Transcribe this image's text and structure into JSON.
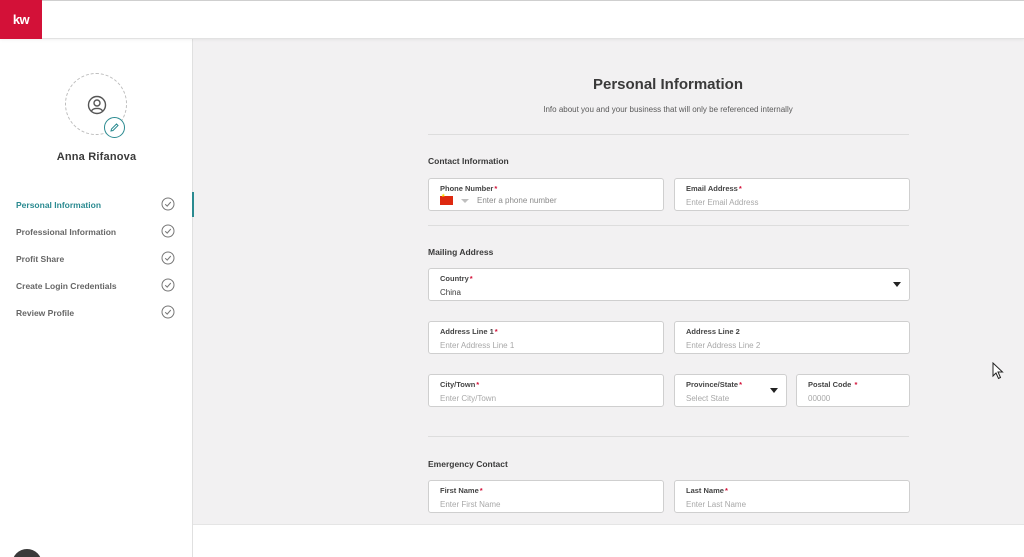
{
  "app": {
    "logo_text": "kw",
    "accent_color": "#d31138",
    "primary_color": "#2a8a90"
  },
  "sidebar": {
    "user_name": "Anna Rifanova",
    "items": [
      {
        "label": "Personal Information",
        "active": true
      },
      {
        "label": "Professional Information",
        "active": false
      },
      {
        "label": "Profit Share",
        "active": false
      },
      {
        "label": "Create Login Credentials",
        "active": false
      },
      {
        "label": "Review Profile",
        "active": false
      }
    ]
  },
  "main": {
    "title": "Personal Information",
    "subtitle": "Info about you and your business that will only be referenced internally",
    "contact": {
      "title": "Contact Information",
      "phone": {
        "label": "Phone Number",
        "placeholder": "Enter a phone number",
        "flag_icon": "china-flag-icon"
      },
      "email": {
        "label": "Email Address",
        "placeholder": "Enter Email Address"
      }
    },
    "mailing": {
      "title": "Mailing Address",
      "country": {
        "label": "Country",
        "value": "China"
      },
      "address1": {
        "label": "Address Line 1",
        "placeholder": "Enter Address Line 1"
      },
      "address2": {
        "label": "Address Line 2",
        "placeholder": "Enter Address Line 2"
      },
      "city": {
        "label": "City/Town",
        "placeholder": "Enter City/Town"
      },
      "province": {
        "label": "Province/State",
        "placeholder": "Select State"
      },
      "postal": {
        "label": "Postal Code",
        "placeholder": "00000"
      }
    },
    "emergency": {
      "title": "Emergency Contact",
      "first_name": {
        "label": "First Name",
        "placeholder": "Enter First Name"
      },
      "last_name": {
        "label": "Last Name",
        "placeholder": "Enter Last Name"
      }
    }
  },
  "required_marker": "*"
}
